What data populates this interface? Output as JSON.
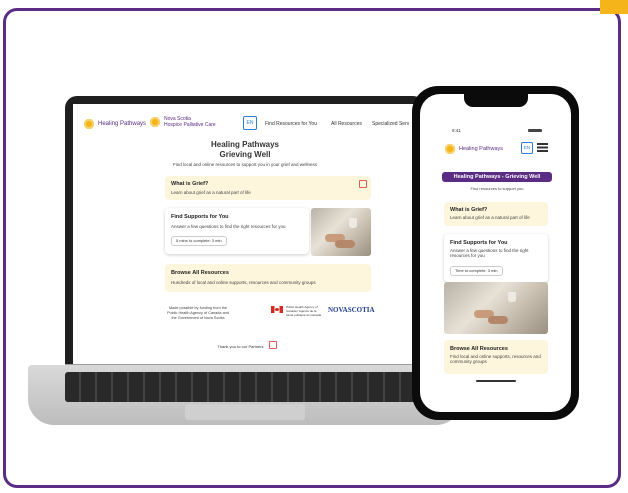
{
  "colors": {
    "frame": "#5b2c83",
    "accent": "#f4b41a",
    "card": "#fdf5dc",
    "link_blue": "#2d7dd2"
  },
  "laptop": {
    "nav": {
      "logo_text": "Healing Pathways",
      "partner_logo_line1": "Nova Scotia",
      "partner_logo_line2": "Hospice Palliative Care",
      "lang_button": "EN",
      "links": [
        "Find Resources for You",
        "All Resources",
        "Specialized Serv"
      ]
    },
    "title_line1": "Healing Pathways",
    "title_line2": "Grieving Well",
    "subtitle": "Find local and online resources to support you in your grief and wellness",
    "cards": {
      "what_is_grief": {
        "heading": "What is Grief?",
        "text": "Learn about grief as a natural part of life"
      },
      "find_supports": {
        "heading": "Find Supports for You",
        "text": "Answer a few questions to find the right resources for you",
        "time": "5 mins to complete: 3 min"
      },
      "browse": {
        "heading": "Browse All Resources",
        "text": "Hundreds of local and online supports, resources and community groups"
      }
    },
    "funding_text": "Made possible by funding from the Public Health Agency of Canada and the Government of Nova Scotia",
    "phac_text": "Public Health Agency of Canada / Agence de la santé publique du Canada",
    "ns_logo": "NOVASCOTIA",
    "thanks": "Thank you to our Partners"
  },
  "phone": {
    "time": "9:41",
    "logo_text": "Healing Pathways",
    "lang_button": "EN",
    "banner": "Healing Pathways - Grieving Well",
    "subtitle": "Find resources to support you",
    "cards": {
      "what_is_grief": {
        "heading": "What is Grief?",
        "text": "Learn about grief as a natural part of life"
      },
      "find_supports": {
        "heading": "Find Supports for You",
        "text": "Answer a few questions to find the right resources for you",
        "time": "Time to complete: 3 min"
      },
      "browse": {
        "heading": "Browse All Resources",
        "text": "Find local and online supports, resources and community groups"
      }
    }
  }
}
